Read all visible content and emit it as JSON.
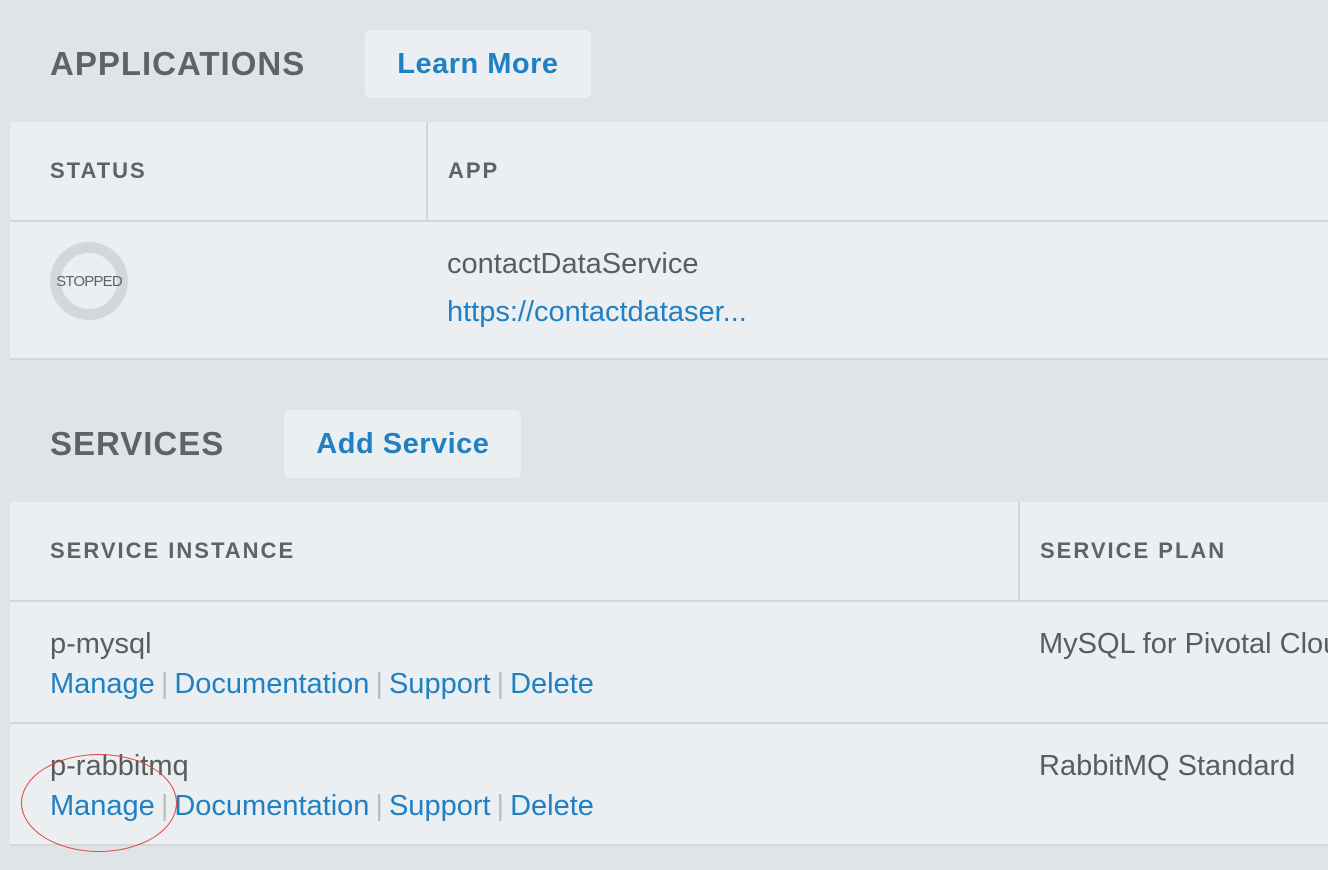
{
  "applications": {
    "title": "APPLICATIONS",
    "learn_more_label": "Learn More",
    "columns": {
      "status": "STATUS",
      "app": "APP"
    },
    "rows": [
      {
        "status": "STOPPED",
        "name": "contactDataService",
        "url": "https://contactdataser..."
      }
    ]
  },
  "services": {
    "title": "SERVICES",
    "add_service_label": "Add Service",
    "columns": {
      "instance": "SERVICE INSTANCE",
      "plan": "SERVICE PLAN"
    },
    "actions": {
      "manage": "Manage",
      "docs": "Documentation",
      "support": "Support",
      "delete": "Delete",
      "separator": "|"
    },
    "rows": [
      {
        "name": "p-mysql",
        "plan": "MySQL for Pivotal Clou"
      },
      {
        "name": "p-rabbitmq",
        "plan": "RabbitMQ Standard"
      }
    ]
  },
  "colors": {
    "accent": "#1f80c4",
    "background": "#e1e4e6",
    "panel": "#ebeff1",
    "annotation": "#e0453a"
  }
}
